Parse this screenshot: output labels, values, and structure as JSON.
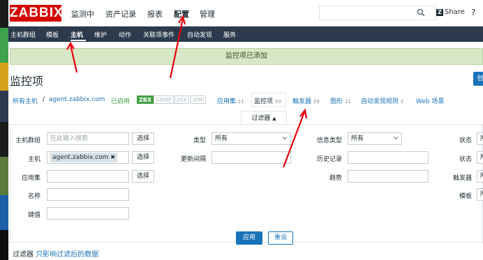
{
  "header": {
    "logo": "ZABBIX",
    "nav": [
      "监测中",
      "资产记录",
      "报表",
      "配置",
      "管理"
    ],
    "active_nav": "配置",
    "share_label": "Share",
    "help": "?"
  },
  "subnav": {
    "items": [
      "主机群组",
      "模板",
      "主机",
      "维护",
      "动作",
      "关联项事件",
      "自动发现",
      "服务"
    ],
    "active": "主机"
  },
  "message": "监控项已添加",
  "page_title": "监控项",
  "create_button_label": "创",
  "breadcrumb": {
    "all_hosts": "所有主机",
    "separator": "/",
    "host": "agent.zabbix.com",
    "status": "已启用",
    "tags": [
      "ZBX",
      "SNMP",
      "JMX",
      "IPMI"
    ],
    "tabs": [
      {
        "label": "应用集",
        "count": "11"
      },
      {
        "label": "监控项",
        "count": "50"
      },
      {
        "label": "触发器",
        "count": "29"
      },
      {
        "label": "图形",
        "count": "11"
      },
      {
        "label": "自动发现规则",
        "count": "2"
      },
      {
        "label": "Web 场景",
        "count": ""
      }
    ]
  },
  "filter": {
    "tab_label": "过滤器",
    "tab_arrow": "▲",
    "host_group_label": "主机群组",
    "host_group_placeholder": "在此输入搜索",
    "select_label": "选择",
    "host_label": "主机",
    "host_value": "agent.zabbix.com",
    "chip_remove": "✖",
    "app_label": "应用集",
    "name_label": "名称",
    "key_label": "键值",
    "type_label": "类型",
    "type_value": "所有",
    "interval_label": "更新间隔",
    "info_type_label": "信息类型",
    "info_type_value": "所有",
    "history_label": "历史记录",
    "trend_label": "趋势",
    "state_label": "状态",
    "state_value": "所",
    "status_label": "状态",
    "status_value": "所",
    "trigger_label": "触发器",
    "trigger_value": "所",
    "template_label": "模板",
    "template_value": "所",
    "apply_label": "应用",
    "reset_label": "重设",
    "note_title": "过滤器",
    "note_text": "只影响过滤后的数据"
  },
  "colors": {
    "brand_red": "#d40000",
    "nav_dark": "#2b3a4d",
    "link_blue": "#1a73b8",
    "success_green": "#d8e8c7",
    "status_green": "#429e47",
    "annotation_red": "#e8000b"
  }
}
